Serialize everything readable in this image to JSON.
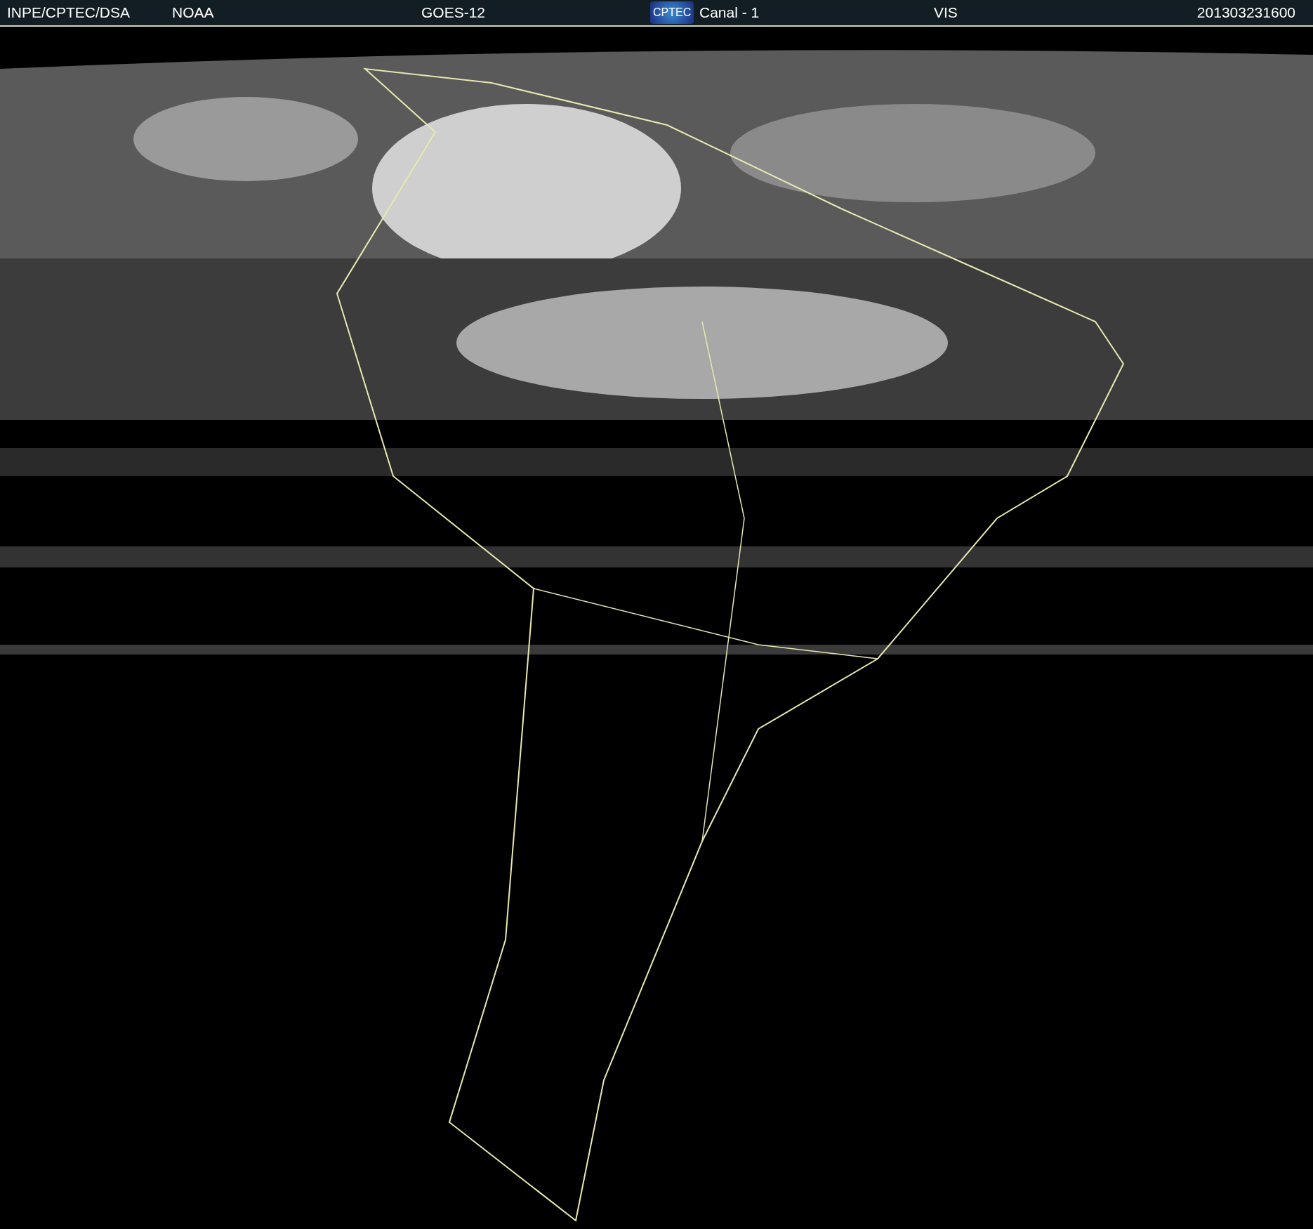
{
  "header": {
    "agency": "INPE/CPTEC/DSA",
    "source": "NOAA",
    "satellite": "GOES-12",
    "logo": "CPTEC",
    "channel": "Canal - 1",
    "band": "VIS",
    "timestamp": "201303231600"
  }
}
